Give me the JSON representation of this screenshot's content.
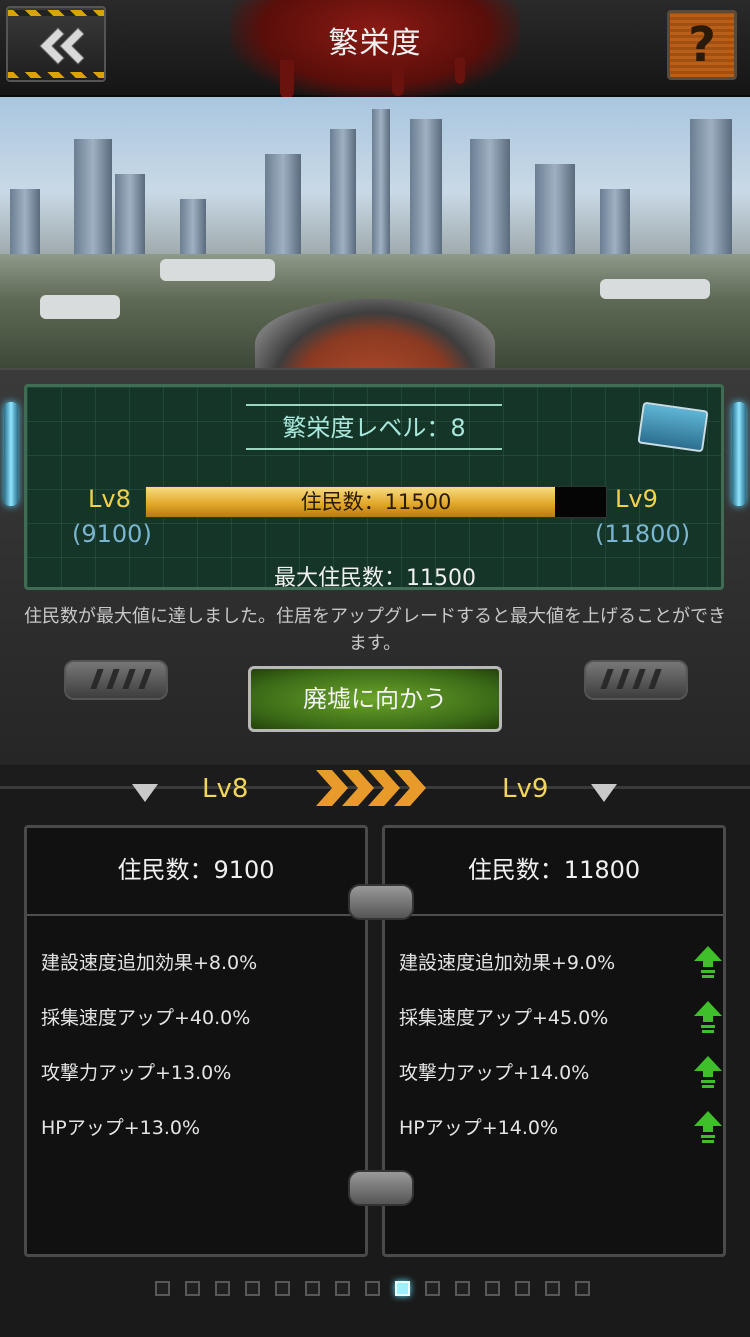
{
  "header": {
    "title": "繁栄度",
    "back_icon": "back-double-chevron-icon",
    "help_label": "?"
  },
  "prosperity": {
    "level_label": "繁栄度レベル：8",
    "current_level": "Lv8",
    "next_level": "Lv9",
    "current_threshold": "(9100)",
    "next_threshold": "(11800)",
    "bar_label": "住民数：11500",
    "progress": 0.89,
    "max_population": "最大住民数：11500"
  },
  "notice": "住民数が最大値に達しました。住居をアップグレードすると最大値を上げることができます。",
  "action": {
    "go_button": "廃墟に向かう"
  },
  "compare": {
    "left_head": "Lv8",
    "right_head": "Lv9",
    "left": {
      "population": "住民数：9100",
      "stats": [
        "建設速度追加効果+8.0%",
        "採集速度アップ+40.0%",
        "攻撃力アップ+13.0%",
        "HPアップ+13.0%"
      ]
    },
    "right": {
      "population": "住民数：11800",
      "stats": [
        "建設速度追加効果+9.0%",
        "採集速度アップ+45.0%",
        "攻撃力アップ+14.0%",
        "HPアップ+14.0%"
      ]
    }
  },
  "pager": {
    "count": 15,
    "active_index": 8
  },
  "colors": {
    "level_gold": "#f3d24a",
    "bar_gold": "#e3a92a",
    "map_green": "#153528",
    "up_green": "#3fbf2a"
  }
}
